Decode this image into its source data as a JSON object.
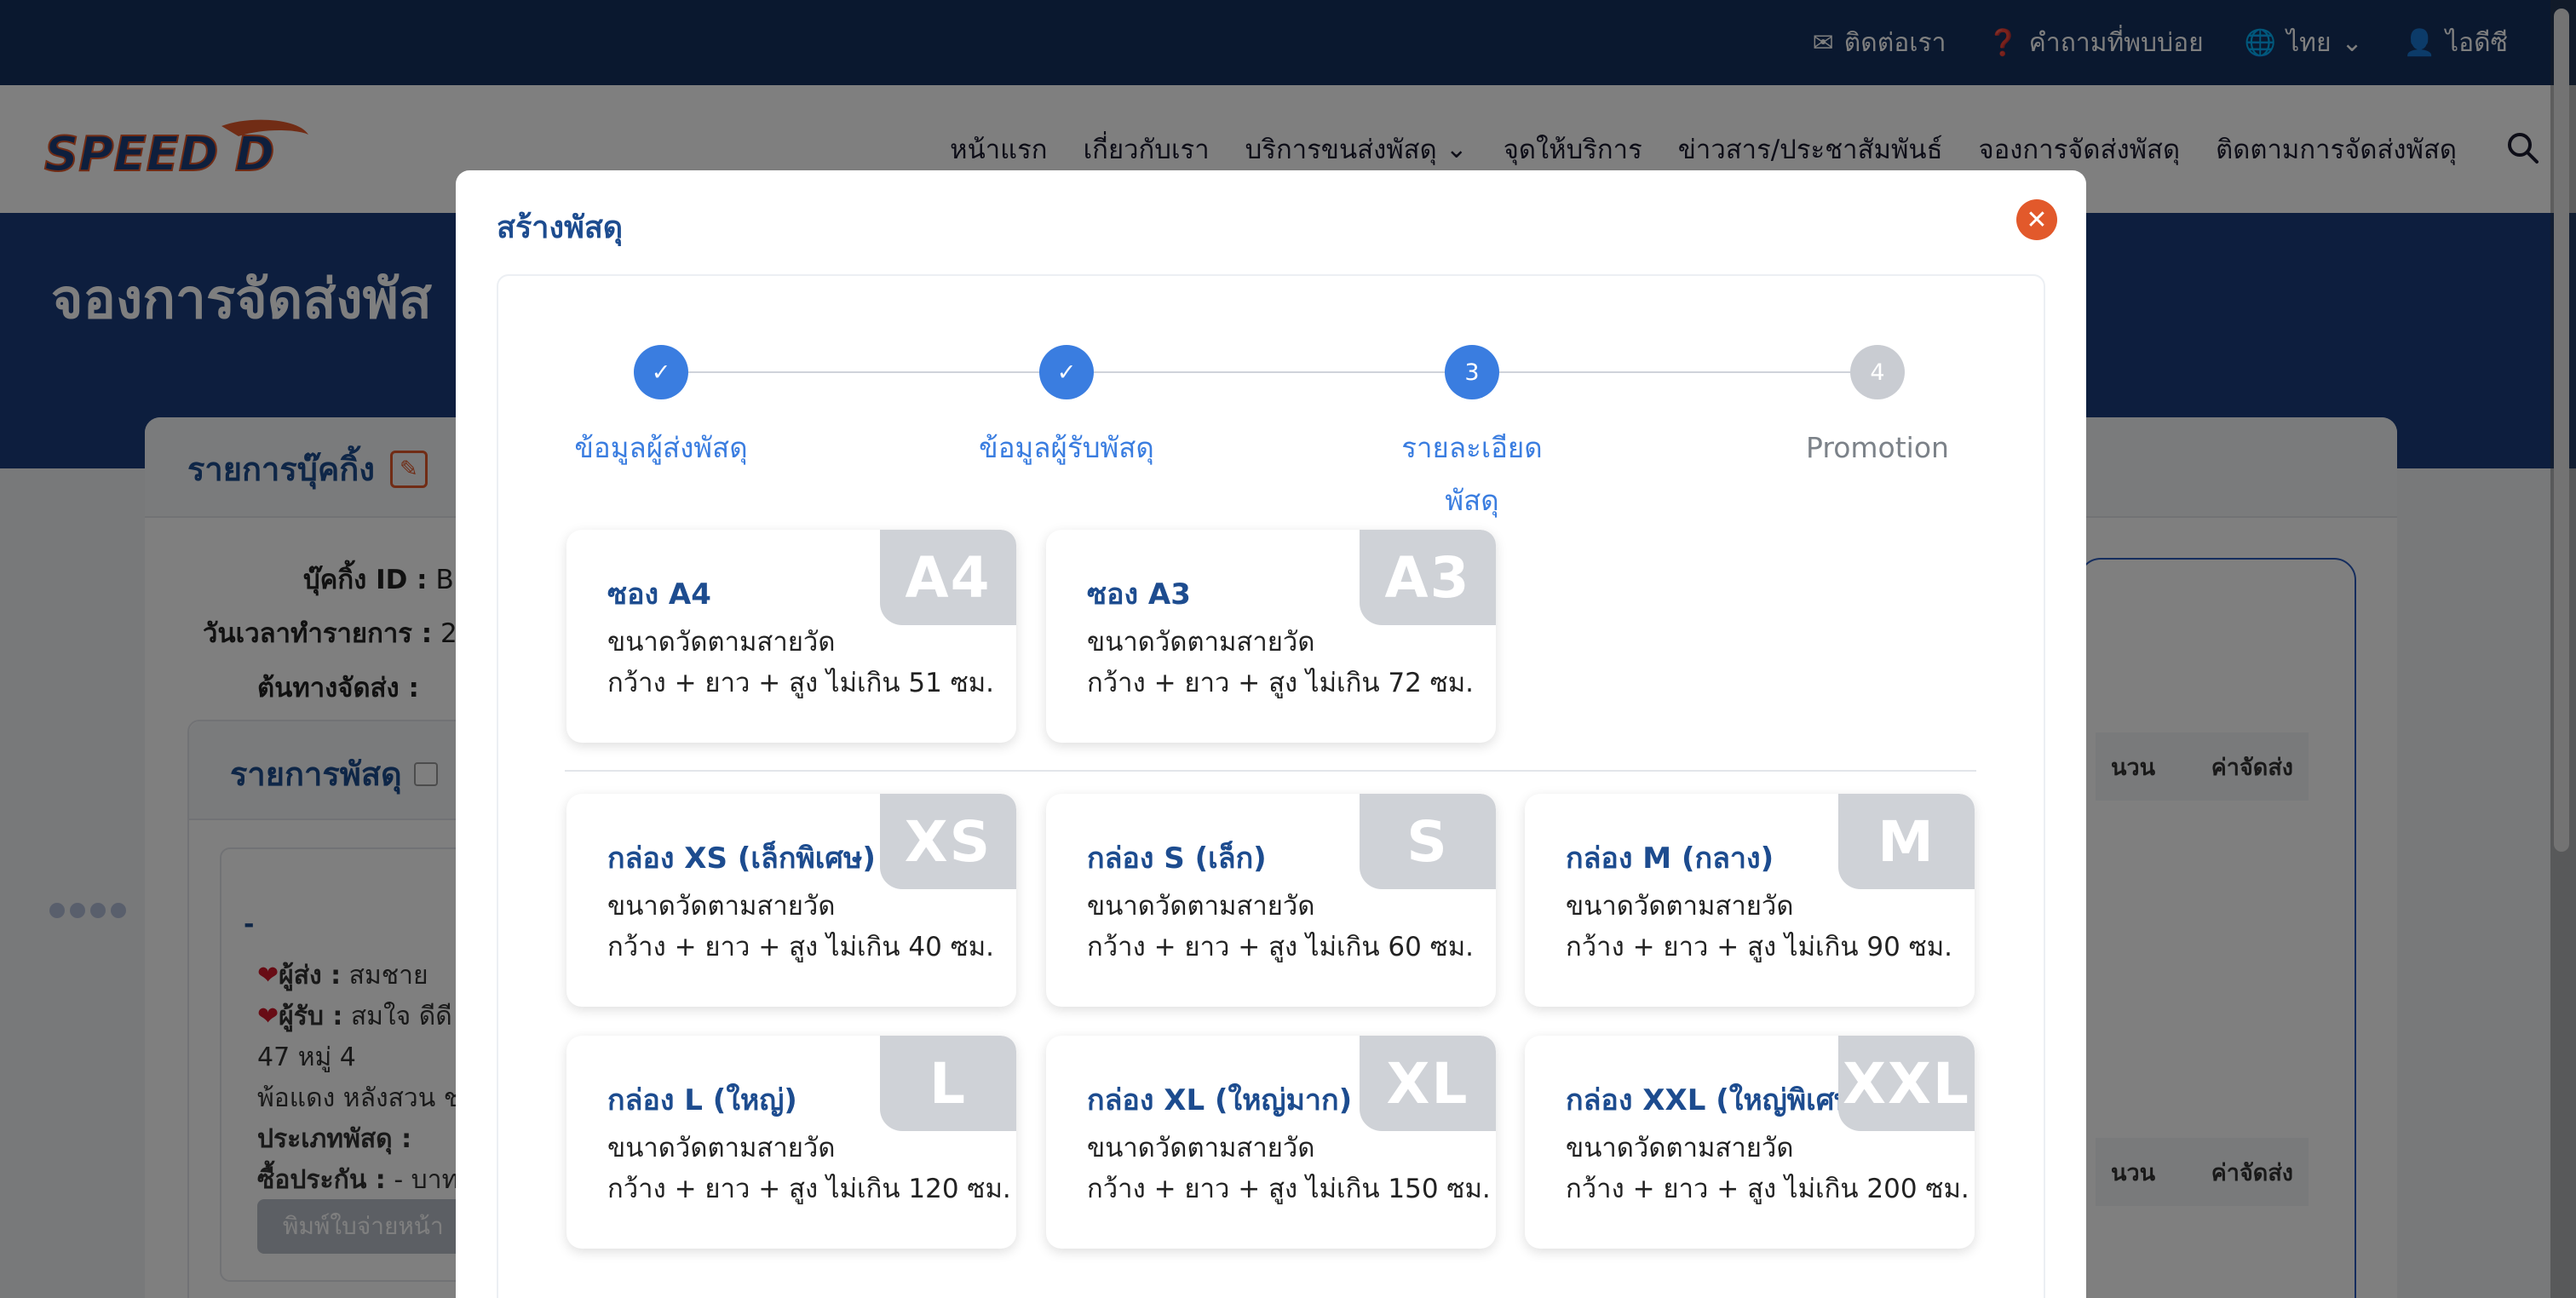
{
  "topbar": {
    "contact": "ติดต่อเรา",
    "faq": "คำถามที่พบบ่อย",
    "language": "ไทย",
    "account": "ไอดีซี"
  },
  "navbar": {
    "logo_text": "SPEED D",
    "items": [
      {
        "label": "หน้าแรก"
      },
      {
        "label": "เกี่ยวกับเรา"
      },
      {
        "label": "บริการขนส่งพัสดุ"
      },
      {
        "label": "จุดให้บริการ"
      },
      {
        "label": "ข่าวสาร/ประชาสัมพันธ์"
      },
      {
        "label": "จองการจัดส่งพัสดุ"
      },
      {
        "label": "ติดตามการจัดส่งพัสดุ"
      }
    ]
  },
  "background_page": {
    "hero_title": "จองการจัดส่งพัส",
    "card_title": "รายการบุ๊คกิ้ง",
    "booking_id_label": "บุ๊คกิ้ง ID :",
    "booking_id_value": "B",
    "datetime_label": "วันเวลาทำรายการ :",
    "datetime_value": "2",
    "origin_label": "ต้นทางจัดส่ง :",
    "parcel_list_title": "รายการพัสดุ",
    "parcel_dash": "-",
    "sender_label": "ผู้ส่ง :",
    "sender_value": "สมชาย",
    "receiver_label": "ผู้รับ :",
    "receiver_value": "สมใจ ดีดี",
    "address_line1": "47 หมู่ 4",
    "address_line2": "พ้อแดง หลังสวน ช",
    "parcel_type_label": "ประเภทพัสดุ :",
    "insurance_label": "ซื้อประกัน :",
    "insurance_value": "- บาท",
    "print_button": "พิมพ์ใบจ่ายหน้า",
    "col_qty": "นวน",
    "col_fee": "ค่าจัดส่ง"
  },
  "modal": {
    "title": "สร้างพัสดุ",
    "steps": [
      {
        "label": "ข้อมูลผู้ส่งพัสดุ",
        "state": "done",
        "number": ""
      },
      {
        "label": "ข้อมูลผู้รับพัสดุ",
        "state": "done",
        "number": ""
      },
      {
        "label_line1": "รายละเอียด",
        "label_line2": "พัสดุ",
        "state": "active",
        "number": "3"
      },
      {
        "label": "Promotion",
        "state": "todo",
        "number": "4"
      }
    ],
    "packages": [
      {
        "badge": "A4",
        "name": "ซอง A4",
        "line1": "ขนาดวัดตามสายวัด",
        "line2": "กว้าง + ยาว + สูง ไม่เกิน 51 ซม."
      },
      {
        "badge": "A3",
        "name": "ซอง A3",
        "line1": "ขนาดวัดตามสายวัด",
        "line2": "กว้าง + ยาว + สูง ไม่เกิน 72 ซม."
      },
      {
        "badge": "XS",
        "name": "กล่อง XS (เล็กพิเศษ)",
        "line1": "ขนาดวัดตามสายวัด",
        "line2": "กว้าง + ยาว + สูง ไม่เกิน 40 ซม."
      },
      {
        "badge": "S",
        "name": "กล่อง S (เล็ก)",
        "line1": "ขนาดวัดตามสายวัด",
        "line2": "กว้าง + ยาว + สูง ไม่เกิน 60 ซม."
      },
      {
        "badge": "M",
        "name": "กล่อง M (กลาง)",
        "line1": "ขนาดวัดตามสายวัด",
        "line2": "กว้าง + ยาว + สูง ไม่เกิน 90 ซม."
      },
      {
        "badge": "L",
        "name": "กล่อง L (ใหญ่)",
        "line1": "ขนาดวัดตามสายวัด",
        "line2": "กว้าง + ยาว + สูง ไม่เกิน 120 ซม."
      },
      {
        "badge": "XL",
        "name": "กล่อง XL (ใหญ่มาก)",
        "line1": "ขนาดวัดตามสายวัด",
        "line2": "กว้าง + ยาว + สูง ไม่เกิน 150 ซม."
      },
      {
        "badge": "XXL",
        "name": "กล่อง XXL (ใหญ่พิเศษ",
        "line1": "ขนาดวัดตามสายวัด",
        "line2": "กว้าง + ยาว + สูง ไม่เกิน 200 ซม."
      }
    ]
  },
  "colors": {
    "brand_blue": "#1d4c8f",
    "step_blue": "#3a7de0",
    "close_orange": "#e2592b",
    "badge_gray": "#cfd2d7"
  }
}
